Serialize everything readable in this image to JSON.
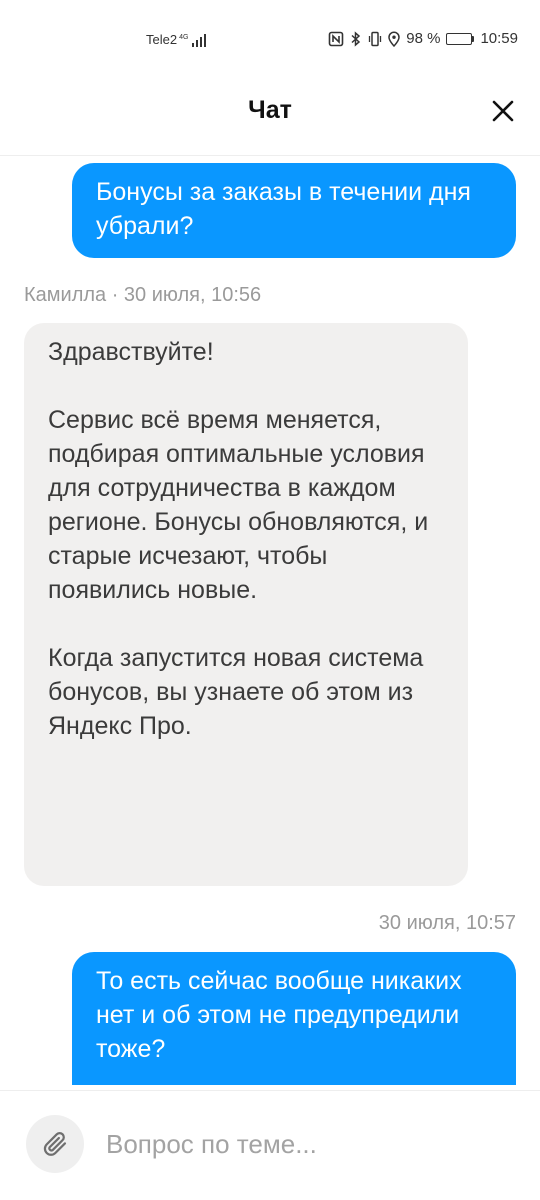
{
  "status_bar": {
    "carrier": "Tele2",
    "network": "4G",
    "battery_percent": "98 %",
    "battery_level": 0.98,
    "time": "10:59",
    "icons": [
      "nfc-icon",
      "bluetooth-icon",
      "vibrate-icon",
      "location-icon"
    ]
  },
  "header": {
    "title": "Чат",
    "close_icon": "close-icon"
  },
  "messages": [
    {
      "direction": "outgoing",
      "text": "Бонусы за заказы в течении дня убрали?"
    },
    {
      "meta": "Камилла · 30 июля, 10:56"
    },
    {
      "direction": "incoming",
      "text": "Здравствуйте!\n\nСервис всё время меняется, подбирая оптимальные условия для сотрудничества в каждом регионе. Бонусы обновляются, и старые исчезают, чтобы появились новые.\n\nКогда запустится новая система бонусов, вы узнаете об этом из Яндекс Про."
    },
    {
      "meta": "30 июля, 10:57"
    },
    {
      "direction": "outgoing",
      "text": "То есть сейчас вообще никаких нет и об этом не предупредили тоже?"
    }
  ],
  "input_bar": {
    "attach_icon": "paperclip-icon",
    "placeholder": "Вопрос по теме..."
  },
  "colors": {
    "outgoing_bubble": "#0a97ff",
    "incoming_bubble": "#f1f0ef",
    "meta_text": "#9a9a9a"
  }
}
